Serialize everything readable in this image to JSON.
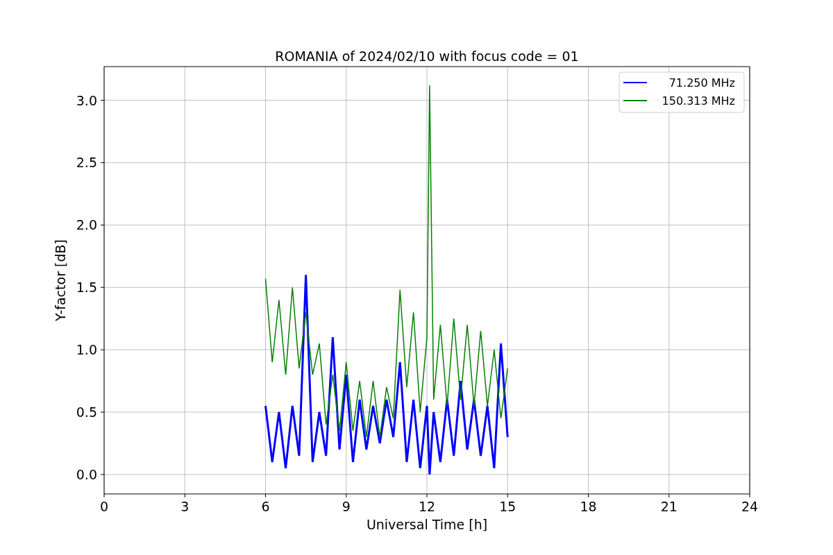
{
  "chart_data": {
    "type": "line",
    "title": "ROMANIA of 2024/02/10 with focus code = 01",
    "xlabel": "Universal Time [h]",
    "ylabel": "Y-factor [dB]",
    "x": [
      6,
      6.25,
      6.5,
      6.75,
      7,
      7.25,
      7.5,
      7.75,
      8,
      8.25,
      8.5,
      8.75,
      9,
      9.25,
      9.5,
      9.75,
      10,
      10.25,
      10.5,
      10.75,
      11,
      11.25,
      11.5,
      11.75,
      12,
      12.1,
      12.25,
      12.5,
      12.75,
      13,
      13.25,
      13.5,
      13.75,
      14,
      14.25,
      14.5,
      14.75,
      15
    ],
    "series": [
      {
        "name": "71.250 MHz",
        "color": "#0000ff",
        "values": [
          0.55,
          0.1,
          0.5,
          0.05,
          0.55,
          0.15,
          1.6,
          0.1,
          0.5,
          0.15,
          1.1,
          0.2,
          0.8,
          0.1,
          0.6,
          0.2,
          0.55,
          0.25,
          0.6,
          0.3,
          0.9,
          0.1,
          0.6,
          0.05,
          0.55,
          0.0,
          0.5,
          0.1,
          0.6,
          0.15,
          0.75,
          0.2,
          0.6,
          0.15,
          0.55,
          0.05,
          1.05,
          0.3
        ]
      },
      {
        "name": "150.313 MHz",
        "color": "#008000",
        "values": [
          1.57,
          0.9,
          1.4,
          0.8,
          1.5,
          0.85,
          1.3,
          0.8,
          1.05,
          0.4,
          0.8,
          0.35,
          0.9,
          0.35,
          0.75,
          0.3,
          0.75,
          0.3,
          0.7,
          0.45,
          1.48,
          0.7,
          1.3,
          0.5,
          1.1,
          3.12,
          0.6,
          1.2,
          0.55,
          1.25,
          0.6,
          1.2,
          0.55,
          1.15,
          0.55,
          1.0,
          0.45,
          0.85
        ]
      }
    ],
    "grid": true,
    "legend": "upper right",
    "xlim": [
      0,
      24
    ],
    "ylim": [
      -0.156,
      3.27
    ],
    "xticks": [
      0,
      3,
      6,
      9,
      12,
      15,
      18,
      21,
      24
    ],
    "yticks": [
      {
        "value": 0,
        "label": "0.0"
      },
      {
        "value": 0.5,
        "label": "0.5"
      },
      {
        "value": 1,
        "label": "1.0"
      },
      {
        "value": 1.5,
        "label": "1.5"
      },
      {
        "value": 2,
        "label": "2.0"
      },
      {
        "value": 2.5,
        "label": "2.5"
      },
      {
        "value": 3,
        "label": "3.0"
      }
    ]
  }
}
